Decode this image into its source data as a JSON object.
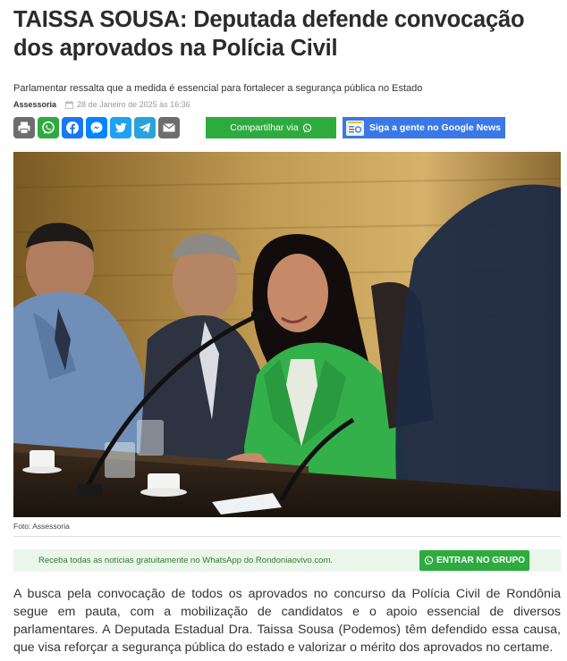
{
  "article": {
    "title": "TAISSA SOUSA: Deputada defende convocação dos aprovados na Polícia Civil",
    "subtitle": "Parlamentar ressalta que a medida é essencial para fortalecer a segurança pública no Estado",
    "author": "Assessoria",
    "date": "28 de Janeiro de 2025 às 16:36",
    "photo_caption": "Foto: Assessoria",
    "body": "A busca pela convocação de todos os aprovados no concurso da Polícia Civil de Rondônia segue em pauta, com a mobilização de candidatos e o apoio essencial de diversos parlamentares. A Deputada Estadual Dra. Taissa Sousa (Podemos) têm defendido essa causa, que visa reforçar a segurança pública do estado e valorizar o mérito dos aprovados no certame."
  },
  "share": {
    "icons": [
      "print-icon",
      "whatsapp-icon",
      "facebook-icon",
      "messenger-icon",
      "twitter-icon",
      "telegram-icon",
      "email-icon"
    ],
    "whatsapp_label": "Compartilhar via",
    "google_news_label": "Siga a gente no Google News"
  },
  "whatsapp_banner": {
    "text": "Receba todas as notícias gratuitamente no WhatsApp do Rondoniaovivo.com.",
    "button_label": "ENTRAR NO GRUPO"
  },
  "colors": {
    "share_grey": "#6d6d6d",
    "whatsapp": "#2eab3e",
    "facebook": "#1877f2",
    "messenger": "#0084ff",
    "twitter": "#1da1f2",
    "telegram": "#2aa3dd",
    "google_news": "#3b78e7",
    "banner_bg": "#eaf6ea"
  }
}
